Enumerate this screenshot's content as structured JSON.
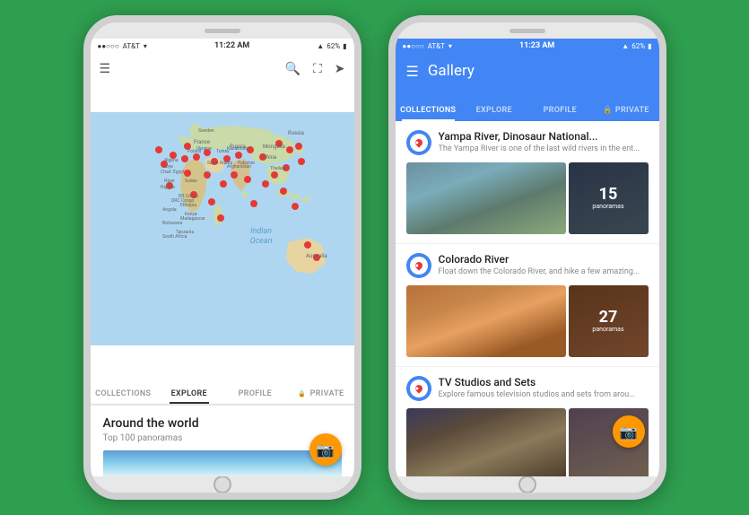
{
  "background_color": "#2e9e4f",
  "phone1": {
    "status_bar": {
      "carrier": "AT&T",
      "time": "11:22 AM",
      "battery": "62%",
      "signal": "▲"
    },
    "tabs": [
      {
        "label": "COLLECTIONS",
        "active": false
      },
      {
        "label": "EXPLORE",
        "active": true
      },
      {
        "label": "PROFILE",
        "active": false
      },
      {
        "label": "PRIVATE",
        "active": false
      }
    ],
    "bottom_card": {
      "title": "Around the world",
      "subtitle": "Top 100 panoramas"
    },
    "fab": {
      "icon": "📷"
    }
  },
  "phone2": {
    "status_bar": {
      "carrier": "AT&T",
      "time": "11:23 AM",
      "battery": "62%"
    },
    "header": {
      "title": "Gallery",
      "menu_icon": "☰"
    },
    "tabs": [
      {
        "label": "COLLECTIONS",
        "active": true
      },
      {
        "label": "EXPLORE",
        "active": false
      },
      {
        "label": "PROFILE",
        "active": false
      },
      {
        "label": "PRIVATE",
        "active": false
      }
    ],
    "gallery_items": [
      {
        "title": "Yampa River, Dinosaur National...",
        "description": "The Yampa River is one of the last wild rivers in the ent...",
        "count": "15",
        "count_label": "panoramas"
      },
      {
        "title": "Colorado River",
        "description": "Float down the Colorado River, and hike a few amazing...",
        "count": "27",
        "count_label": "panoramas"
      },
      {
        "title": "TV Studios and Sets",
        "description": "Explore famous television studios and sets from arou...",
        "count": "",
        "count_label": ""
      }
    ],
    "fab": {
      "icon": "📷"
    }
  }
}
